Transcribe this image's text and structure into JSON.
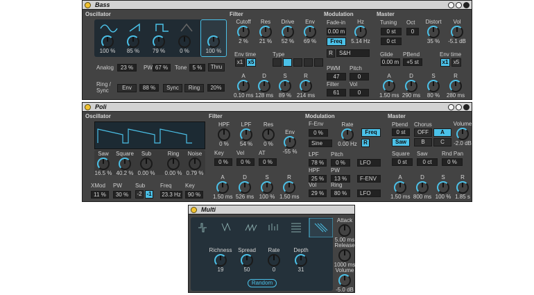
{
  "bass": {
    "title": "Bass",
    "oscillator": {
      "label": "Oscillator",
      "levels": [
        "100 %",
        "85 %",
        "79 %",
        "0 %",
        "100 %"
      ],
      "analog_label": "Analog",
      "analog": "23 %",
      "pw_label": "PW",
      "pw": "67 %",
      "tone_label": "Tone",
      "tone": "5 %",
      "thru": "Thru",
      "ring_label": "Ring / Sync",
      "env": "Env",
      "ring_amt": "88 %",
      "sync": "Sync",
      "ring": "Ring",
      "ring_val": "20%"
    },
    "filter": {
      "label": "Filter",
      "cutoff_label": "Cutoff",
      "cutoff": "2 %",
      "res_label": "Res",
      "res": "21 %",
      "drive_label": "Drive",
      "drive": "52 %",
      "env_label": "Env",
      "env": "69 %",
      "envtime_label": "Env time",
      "x1": "x1",
      "x5": "x5",
      "type_label": "Type",
      "a_label": "A",
      "a": "0.10 ms",
      "d_label": "D",
      "d": "128 ms",
      "s_label": "S",
      "s": "89 %",
      "r_label": "R",
      "r": "214 ms"
    },
    "modulation": {
      "label": "Modulation",
      "fadein_label": "Fade-in",
      "fadein": "0.00 m",
      "hz_label": "Hz",
      "hz": "5.14 Hz",
      "freq": "Freq",
      "r": "R",
      "sh": "S&H",
      "pwm_label": "PWM",
      "pwm": "47",
      "pitch_label": "Pitch",
      "pitch": "0",
      "filter_label": "Filter",
      "filter": "61",
      "vol_label": "Vol",
      "vol": "0"
    },
    "master": {
      "label": "Master",
      "tuning_label": "Tuning",
      "tuning": "0 st",
      "oct_label": "Oct",
      "oct": "0",
      "ct": "0 ct",
      "distort_label": "Distort",
      "distort": "35 %",
      "vol_label": "Vol",
      "vol": "-5.1 dB",
      "glide_label": "Glide",
      "glide": "0.00 m",
      "pbend_label": "PBend",
      "pbend": "+5 st",
      "envtime_label": "Env time",
      "x1": "x1",
      "x5": "x5",
      "a_label": "A",
      "a": "1.50 ms",
      "d_label": "D",
      "d": "290 ms",
      "s_label": "S",
      "s": "80 %",
      "r_label": "R",
      "r": "280 ms"
    }
  },
  "poli": {
    "title": "Poli",
    "oscillator": {
      "label": "Oscillator",
      "saw_label": "Saw",
      "saw": "16.5 %",
      "square_label": "Square",
      "square": "40.2 %",
      "sub_label": "Sub",
      "sub": "0.00 %",
      "ring_label": "Ring",
      "ring": "0.00 %",
      "noise_label": "Noise",
      "noise": "0.79 %",
      "xmod_label": "XMod",
      "xmod": "11 %",
      "pw_label": "PW",
      "pw": "30 %",
      "sub2_label": "Sub",
      "sub_m2": "-2",
      "sub_m1": "-1",
      "freq_label": "Freq",
      "freq": "23.3 Hz",
      "key_label": "Key",
      "key": "90 %"
    },
    "filter": {
      "label": "Filter",
      "hpf_label": "HPF",
      "hpf": "0 %",
      "lpf_label": "LPF",
      "lpf": "54 %",
      "res_label": "Res",
      "res": "0 %",
      "env_label": "Env",
      "env": "-55 %",
      "key_label": "Key",
      "key": "0 %",
      "vel_label": "Vel",
      "vel": "0 %",
      "at_label": "AT",
      "at": "0 %",
      "a_label": "A",
      "a": "1.50 ms",
      "d_label": "D",
      "d": "526 ms",
      "s_label": "S",
      "s": "100 %",
      "r_label": "R",
      "r": "1.50 ms"
    },
    "modulation": {
      "label": "Modulation",
      "fenv_label": "F-Env",
      "fenv": "0 %",
      "rate_label": "Rate",
      "rate": "0.00 Hz",
      "freq": "Freq",
      "r": "R",
      "sine": "Sine",
      "lpf_label": "LPF",
      "lpf": "78 %",
      "pitch_label": "Pitch",
      "pitch": "0 %",
      "pitch_src": "LFO",
      "hpf_label": "HPF",
      "hpf": "25 %",
      "pw_label": "PW",
      "pw": "13 %",
      "pw_src": "F-ENV",
      "vol_label": "Vol",
      "vol": "29 %",
      "ring_label": "Ring",
      "ring": "80 %",
      "ring_src": "LFO"
    },
    "master": {
      "label": "Master",
      "pbend_label": "Pbend",
      "pbend": "0 st",
      "chorus_label": "Chorus",
      "chorus_off": "OFF",
      "chorus_a": "A",
      "chorus_b": "B",
      "chorus_c": "C",
      "volume_label": "Volume",
      "volume": "-2.0 dB",
      "saw_btn": "Saw",
      "square_label": "Square",
      "square": "0 st",
      "saw_label": "Saw",
      "saw": "0 ct",
      "rndpan_label": "Rnd Pan",
      "rndpan": "0 %",
      "a_label": "A",
      "a": "1.50 ms",
      "d_label": "D",
      "d": "800 ms",
      "s_label": "S",
      "s": "100 %",
      "r_label": "R",
      "r": "1.85 s"
    }
  },
  "multi": {
    "title": "Multi",
    "richness_label": "Richness",
    "richness": "19",
    "spread_label": "Spread",
    "spread": "50",
    "rate_label": "Rate",
    "rate": "0",
    "depth_label": "Depth",
    "depth": "31",
    "random": "Random",
    "attack_label": "Attack",
    "attack": "5.00 ms",
    "release_label": "Release",
    "release": "1000 ms",
    "volume_label": "Volume",
    "volume": "-5.0 dB"
  }
}
